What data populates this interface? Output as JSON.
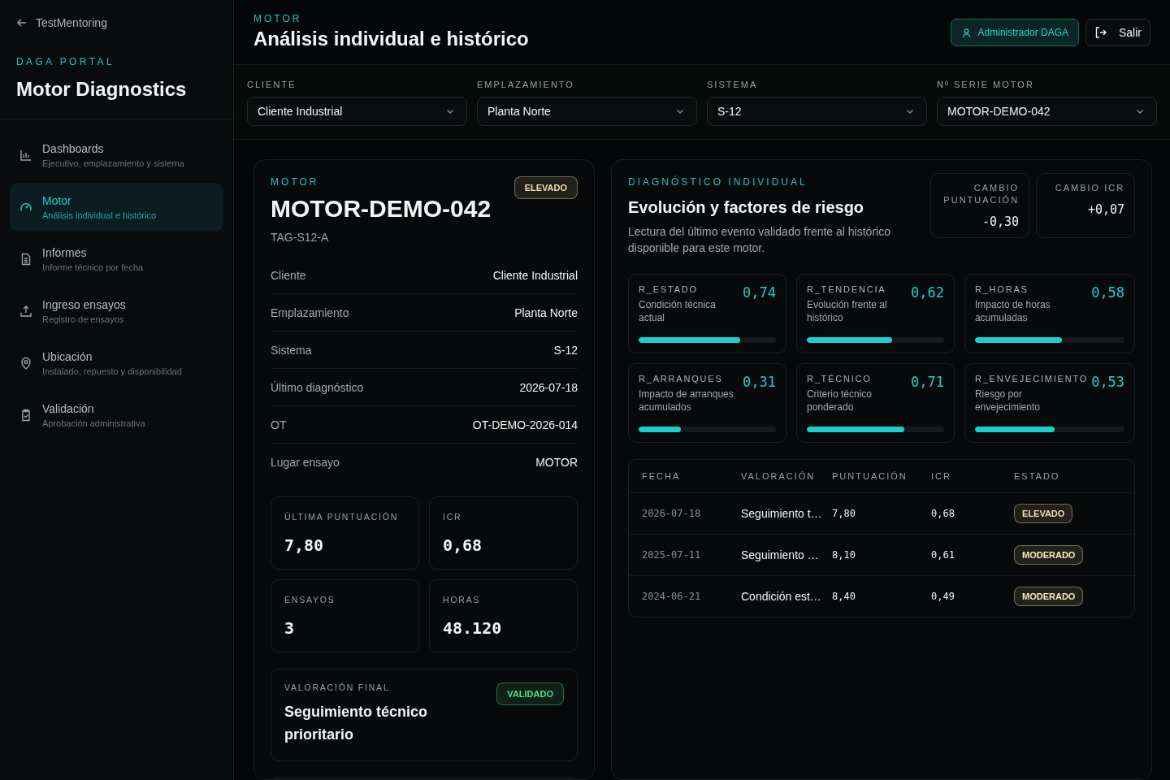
{
  "sidebar": {
    "back_link": "TestMentoring",
    "brand": "DAGA PORTAL",
    "app_title": "Motor Diagnostics",
    "items": [
      {
        "label": "Dashboards",
        "sublabel": "Ejecutivo, emplazamiento y sistema",
        "selected": false
      },
      {
        "label": "Motor",
        "sublabel": "Análisis individual e histórico",
        "selected": true
      },
      {
        "label": "Informes",
        "sublabel": "Informe técnico por fecha",
        "selected": false
      },
      {
        "label": "Ingreso ensayos",
        "sublabel": "Registro de ensayos",
        "selected": false
      },
      {
        "label": "Ubicación",
        "sublabel": "Instalado, repuesto y disponibilidad",
        "selected": false
      },
      {
        "label": "Validación",
        "sublabel": "Aprobación administrativa",
        "selected": false
      }
    ]
  },
  "header": {
    "eyebrow": "MOTOR",
    "title": "Análisis individual e histórico",
    "user_button": "Administrador DAGA",
    "logout_button": "Salir"
  },
  "filters": [
    {
      "label": "CLIENTE",
      "value": "Cliente Industrial"
    },
    {
      "label": "EMPLAZAMIENTO",
      "value": "Planta Norte"
    },
    {
      "label": "SISTEMA",
      "value": "S-12"
    },
    {
      "label": "Nº SERIE MOTOR",
      "value": "MOTOR-DEMO-042"
    }
  ],
  "motor_card": {
    "eyebrow": "MOTOR",
    "name": "MOTOR-DEMO-042",
    "tag": "TAG-S12-A",
    "badge": {
      "text": "ELEVADO",
      "color": "#f3dfb1"
    },
    "details": [
      {
        "label": "Cliente",
        "value": "Cliente Industrial"
      },
      {
        "label": "Emplazamiento",
        "value": "Planta Norte"
      },
      {
        "label": "Sistema",
        "value": "S-12"
      },
      {
        "label": "Último diagnóstico",
        "value": "2026-07-18"
      },
      {
        "label": "OT",
        "value": "OT-DEMO-2026-014"
      },
      {
        "label": "Lugar ensayo",
        "value": "MOTOR"
      }
    ],
    "stats": [
      {
        "label": "ÚLTIMA PUNTUACIÓN",
        "value": "7,80"
      },
      {
        "label": "ICR",
        "value": "0,68"
      },
      {
        "label": "ENSAYOS",
        "value": "3"
      },
      {
        "label": "HORAS",
        "value": "48.120"
      }
    ],
    "final": {
      "label": "VALORACIÓN FINAL",
      "text": "Seguimiento técnico prioritario",
      "badge": {
        "text": "VALIDADO",
        "color": "#4ee08a"
      }
    }
  },
  "diagnosis": {
    "eyebrow": "DIAGNÓSTICO INDIVIDUAL",
    "title": "Evolución y factores de riesgo",
    "description": "Lectura del último evento validado frente al histórico disponible para este motor.",
    "changes": [
      {
        "label": "CAMBIO PUNTUACIÓN",
        "value": "-0,30"
      },
      {
        "label": "CAMBIO ICR",
        "value": "+0,07"
      }
    ],
    "factors": [
      {
        "code": "R_ESTADO",
        "description": "Condición técnica actual",
        "value": "0,74",
        "level": 0.74
      },
      {
        "code": "R_TENDENCIA",
        "description": "Evolución frente al histórico",
        "value": "0,62",
        "level": 0.62
      },
      {
        "code": "R_HORAS",
        "description": "Impacto de horas acumuladas",
        "value": "0,58",
        "level": 0.58
      },
      {
        "code": "R_ARRANQUES",
        "description": "Impacto de arranques acumulados",
        "value": "0,31",
        "level": 0.31
      },
      {
        "code": "R_TÉCNICO",
        "description": "Criterio técnico ponderado",
        "value": "0,71",
        "level": 0.71
      },
      {
        "code": "R_ENVEJECIMIENTO",
        "description": "Riesgo por envejecimiento",
        "value": "0,53",
        "level": 0.53
      }
    ],
    "table": {
      "columns": [
        "FECHA",
        "VALORACIÓN",
        "PUNTUACIÓN",
        "ICR",
        "ESTADO"
      ],
      "rows": [
        {
          "date": "2026-07-18",
          "assessment": "Seguimiento t…",
          "score": "7,80",
          "icr": "0,68",
          "status": {
            "text": "ELEVADO",
            "color": "#f3dfb1"
          }
        },
        {
          "date": "2025-07-11",
          "assessment": "Seguimiento …",
          "score": "8,10",
          "icr": "0,61",
          "status": {
            "text": "MODERADO",
            "color": "#f6ecb5"
          }
        },
        {
          "date": "2024-06-21",
          "assessment": "Condición est…",
          "score": "8,40",
          "icr": "0,49",
          "status": {
            "text": "MODERADO",
            "color": "#f6ecb5"
          }
        }
      ]
    }
  }
}
